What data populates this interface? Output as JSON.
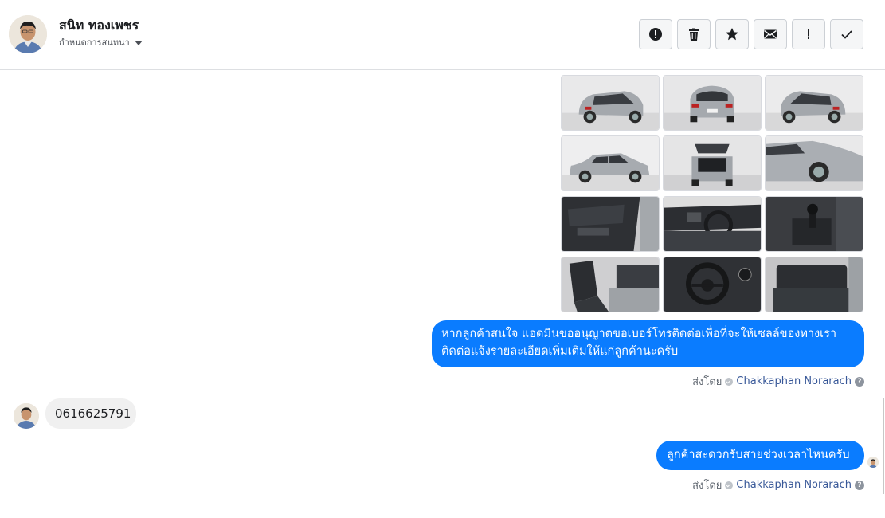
{
  "header": {
    "contact_name": "สนิท ทองเพชร",
    "assign_label": "กำหนดการสนทนา",
    "toolbar": [
      {
        "name": "spam-button",
        "icon": "alert-circle-icon"
      },
      {
        "name": "delete-button",
        "icon": "trash-icon"
      },
      {
        "name": "star-button",
        "icon": "star-icon"
      },
      {
        "name": "mark-unread-button",
        "icon": "envelope-icon"
      },
      {
        "name": "follow-up-button",
        "icon": "exclamation-icon"
      },
      {
        "name": "mark-done-button",
        "icon": "checkmark-icon"
      }
    ]
  },
  "photos": [
    {
      "view": "rear-left"
    },
    {
      "view": "rear"
    },
    {
      "view": "rear-right"
    },
    {
      "view": "side"
    },
    {
      "view": "trunk-open"
    },
    {
      "view": "front-detail"
    },
    {
      "view": "door-panel"
    },
    {
      "view": "dashboard"
    },
    {
      "view": "gear-shifter"
    },
    {
      "view": "front-seats"
    },
    {
      "view": "steering-wheel"
    },
    {
      "view": "rear-seats"
    }
  ],
  "messages": {
    "outgoing_1_line1": "หากลูกค้าสนใจ แอดมินขออนุญาตขอเบอร์โทรติดต่อเพื่อที่จะให้เซลล์ของทางเรา",
    "outgoing_1_line2": "ติดต่อแจ้งรายละเอียดเพิ่มเติมให้แก่ลูกค้านะครับ",
    "incoming_1": "0616625791",
    "outgoing_2": "ลูกค้าสะดวกรับสายช่วงเวลาไหนครับ"
  },
  "sent_by": {
    "prefix": "ส่งโดย",
    "agent": "Chakkaphan Norarach",
    "help": "?"
  },
  "colors": {
    "outgoing_bubble": "#0a7cff",
    "incoming_bubble": "#f0f0f0",
    "agent_link": "#385898"
  }
}
